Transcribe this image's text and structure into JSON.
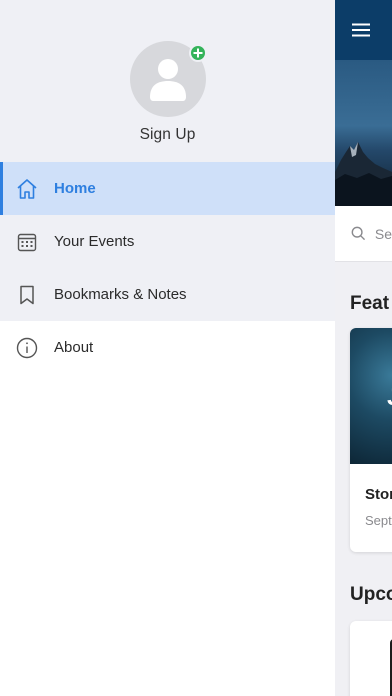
{
  "drawer": {
    "profile": {
      "signup_label": "Sign Up"
    },
    "menu": [
      {
        "label": "Home",
        "icon": "home-icon",
        "active": true
      },
      {
        "label": "Your Events",
        "icon": "calendar-icon",
        "active": false
      },
      {
        "label": "Bookmarks & Notes",
        "icon": "bookmark-icon",
        "active": false
      },
      {
        "label": "About",
        "icon": "info-icon",
        "active": false
      }
    ]
  },
  "background_app": {
    "search_placeholder": "Se",
    "featured_title": "Feat",
    "featured_card": {
      "image_glyph": "J",
      "title": "Stor",
      "subtitle": "Sept"
    },
    "upcoming_title": "Upco"
  },
  "colors": {
    "accent": "#2e7fe0",
    "active_bg": "#cfe0f9",
    "header_bg": "#eff0f5",
    "topbar": "#0c3d68",
    "add_badge": "#34b35a"
  }
}
